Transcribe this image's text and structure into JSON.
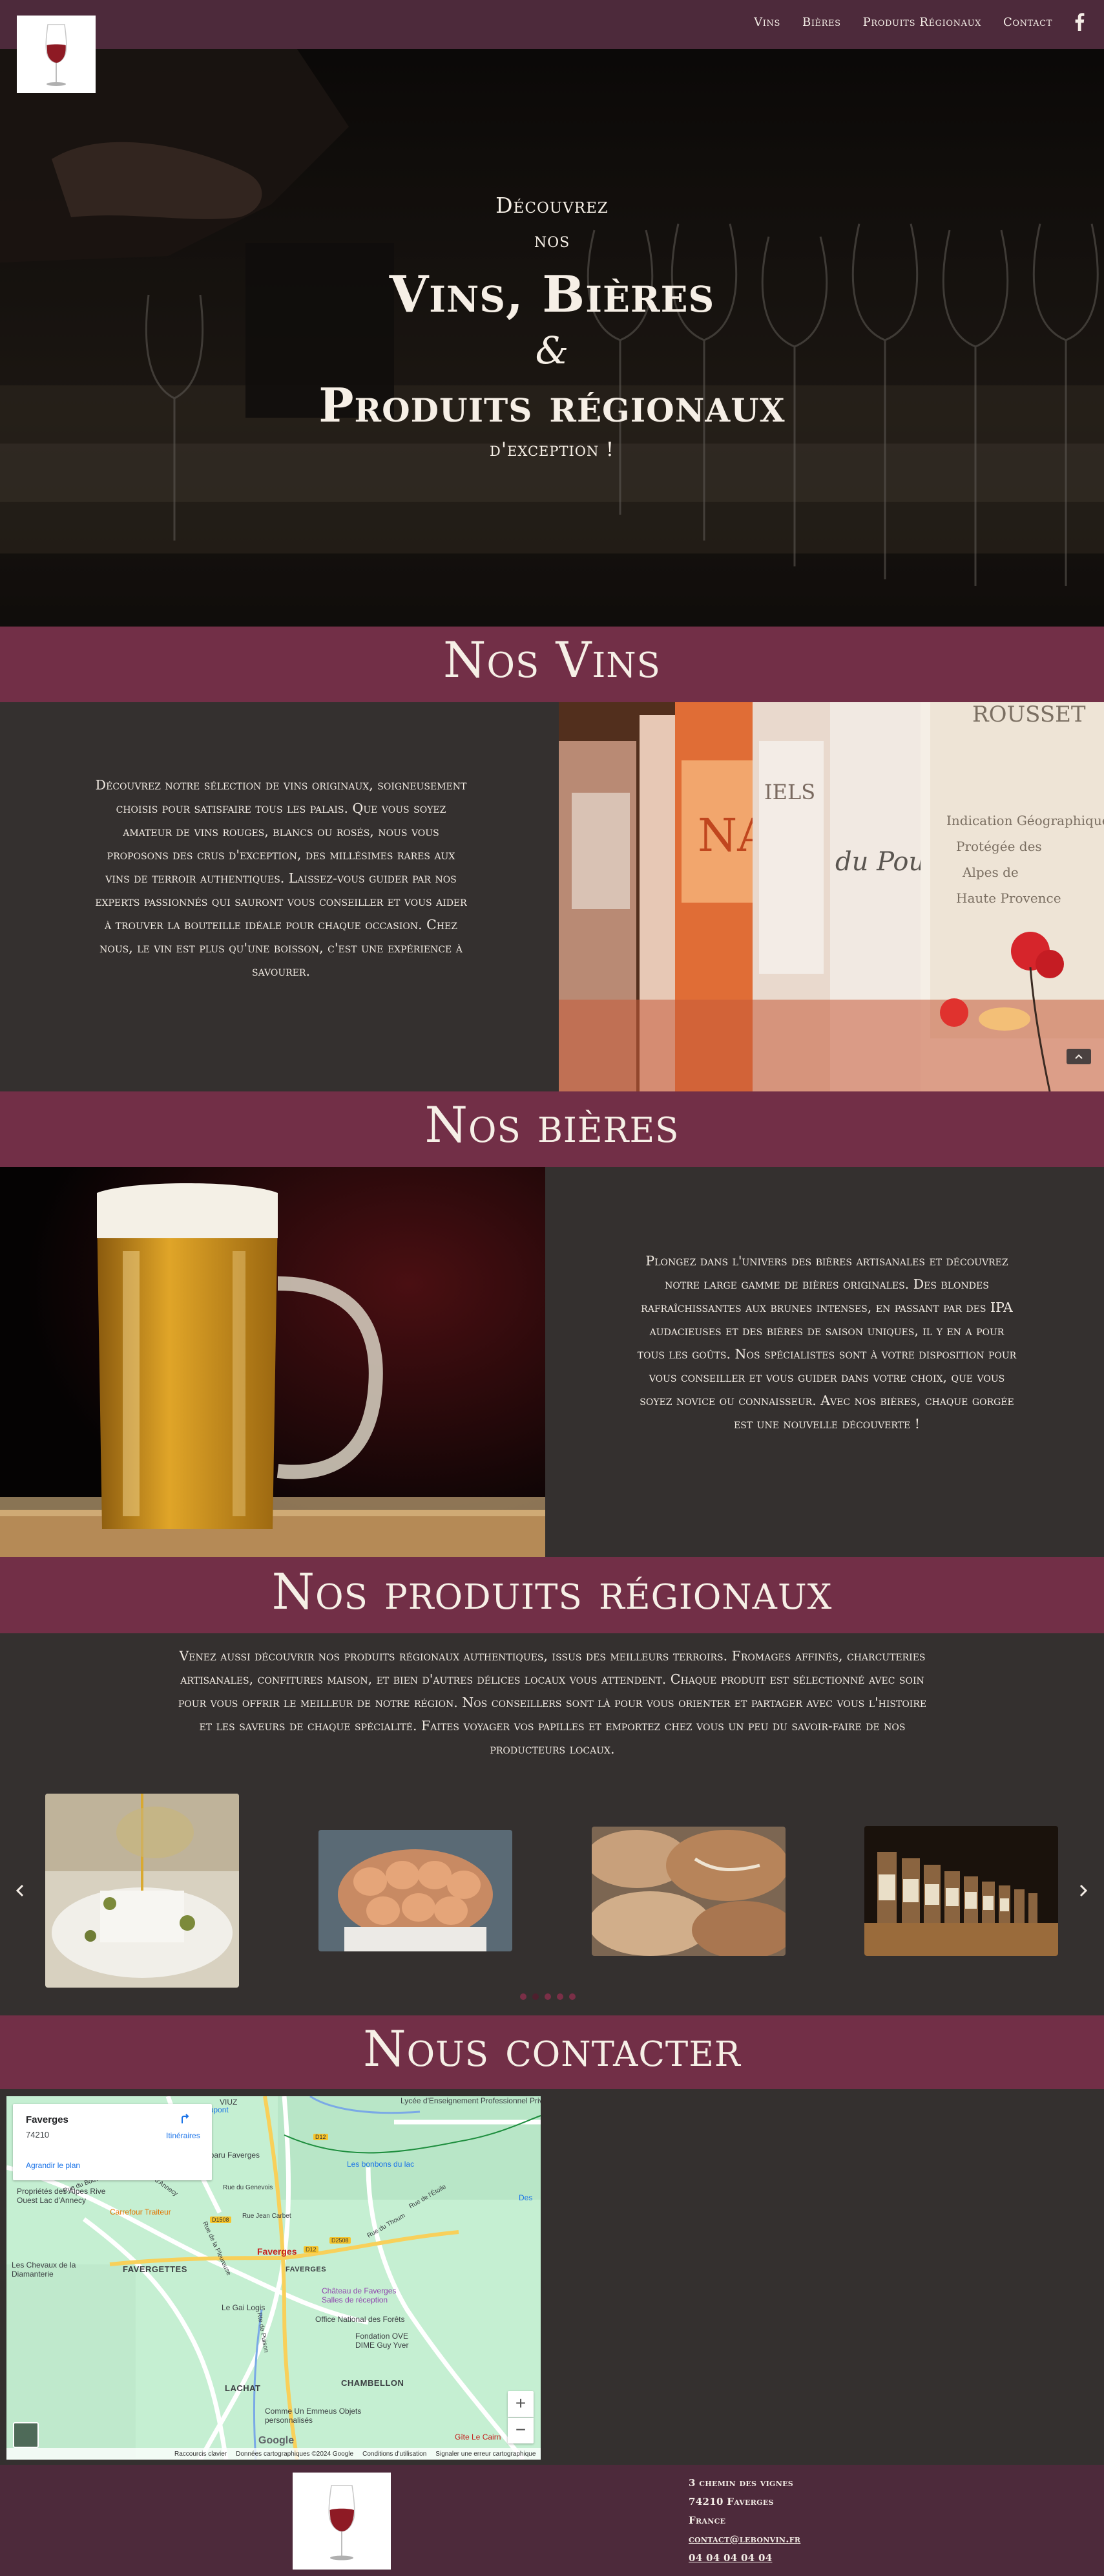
{
  "nav": {
    "items": [
      "Vins",
      "Bières",
      "Produits Régionaux",
      "Contact"
    ],
    "social_icon": "facebook-icon"
  },
  "hero": {
    "pre1": "Découvrez",
    "pre2": "nos",
    "title1": "Vins, Bières",
    "amp": "&",
    "title2": "Produits régionaux",
    "post": "d'exception !"
  },
  "sections": {
    "vins": {
      "title": "Nos Vins",
      "text": "Découvrez notre sélection de vins originaux, soigneusement choisis pour satisfaire tous les palais. Que vous soyez amateur de vins rouges, blancs ou rosés, nous vous proposons des crus d'exception, des millésimes rares aux vins de terroir authentiques. Laissez-vous guider par nos experts passionnés qui sauront vous conseiller et vous aider à trouver la bouteille idéale pour chaque occasion. Chez nous, le vin est plus qu'une boisson, c'est une expérience à savourer."
    },
    "bieres": {
      "title": "Nos bières",
      "text": "Plongez dans l'univers des bières artisanales et découvrez notre large gamme de bières originales. Des blondes rafraîchissantes aux brunes intenses, en passant par des IPA audacieuses et des bières de saison uniques, il y en a pour tous les goûts. Nos spécialistes sont à votre disposition pour vous conseiller et vous guider dans votre choix, que vous soyez novice ou connaisseur. Avec nos bières, chaque gorgée est une nouvelle découverte !"
    },
    "produits": {
      "title": "Nos produits régionaux",
      "text": "Venez aussi découvrir nos produits régionaux authentiques, issus des meilleurs terroirs. Fromages affinés, charcuteries artisanales, confitures maison, et bien d'autres délices locaux vous attendent. Chaque produit est sélectionné avec soin pour vous offrir le meilleur de notre région. Nos conseillers sont là pour vous orienter et partager avec vous l'histoire et les saveurs de chaque spécialité. Faites voyager vos papilles et emportez chez vous un peu du savoir-faire de nos producteurs locaux."
    },
    "contact": {
      "title": "Nous contacter"
    }
  },
  "carousel": {
    "slide_count": 5,
    "active_index": 1
  },
  "map": {
    "place": "Faverges",
    "zip": "74210",
    "enlarge": "Agrandir le plan",
    "route": "Itinéraires",
    "zoom_in": "+",
    "zoom_out": "−",
    "footer": [
      "Raccourcis clavier",
      "Données cartographiques ©2024 Google",
      "Conditions d'utilisation",
      "Signaler une erreur cartographique"
    ],
    "google": "Google",
    "labels": {
      "viuz": "VIUZ",
      "dupont": "Dupont",
      "lycee": "Lycée d'Enseignement Professionnel Privé La...",
      "subaru": "Subaru Faverges",
      "bonbons": "Les bonbons du lac",
      "proprietes": "Propriétés des Alpes Rive Ouest Lac d'Annecy",
      "carrefour": "Carrefour Traiteur",
      "chevaux": "Les Chevaux de la Diamanterie",
      "favergettes": "FAVERGETTES",
      "faverges_red": "Faverges",
      "faverges_grey": "FAVERGES",
      "chateau": "Château de Faverges Salles de réception",
      "gai_logis": "Le Gai Logis",
      "onf": "Office National des Forêts",
      "fondation": "Fondation OVE DIME Guy Yver",
      "lachat": "LACHAT",
      "chambellon": "CHAMBELLON",
      "emmeus": "Comme Un Emmeus Objets personnalisés",
      "gite": "Gîte Le Cairn",
      "rue_bouvier": "Rue du Bouvier",
      "rte_annecy": "Rte d'Annecy",
      "rue_genevois": "Rue du Genevois",
      "rue_jean": "Rue Jean Carbet",
      "rue_pleureuse": "Rue de la Pleureuse",
      "rue_thoum": "Rue du Thoum",
      "rue_etoile": "Rue de l'Étoile",
      "rte_puison": "Rte de Puison",
      "d1508": "D1508",
      "d12": "D12",
      "d12b": "D12",
      "d2508": "D2508",
      "des": "Des"
    }
  },
  "footer": {
    "address": [
      "3 chemin des vignes",
      "74210 Faverges",
      "France"
    ],
    "email": "contact@lebonvin.fr",
    "phone": "04 04 04 04 04"
  },
  "colors": {
    "nav_bg": "#4d2a3b",
    "band_bg": "#722f47",
    "page_bg": "#34302f",
    "text": "#f4ede6"
  }
}
